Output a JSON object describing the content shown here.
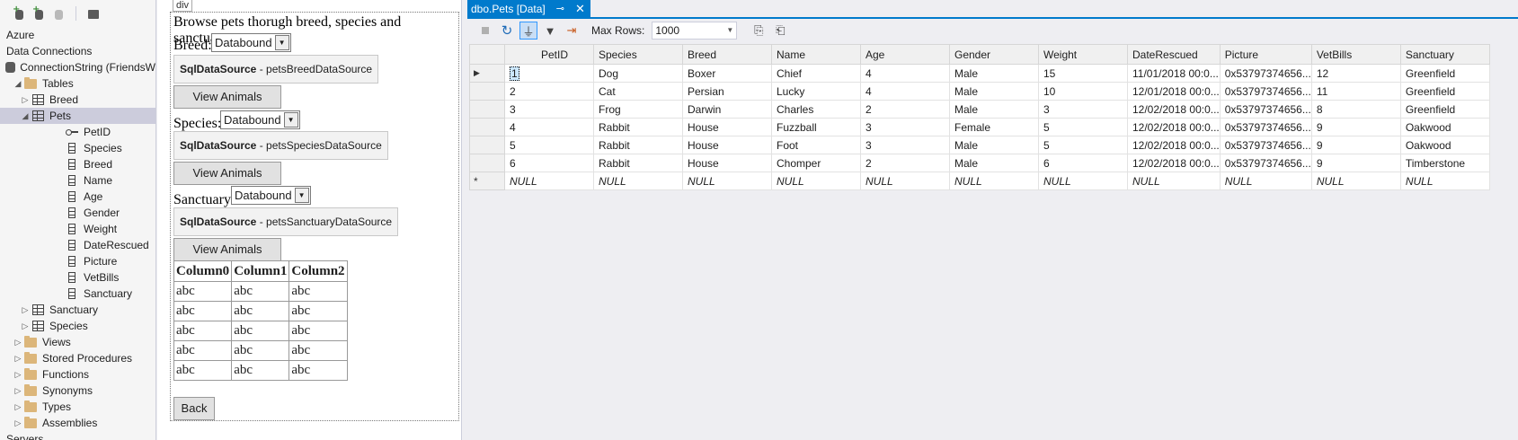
{
  "explorer": {
    "tree": [
      {
        "label": "Azure",
        "indent": 0,
        "arrow": "",
        "icon": "none"
      },
      {
        "label": "Data Connections",
        "indent": 0,
        "arrow": "",
        "icon": "none"
      },
      {
        "label": "ConnectionString (FriendsW",
        "indent": 0,
        "arrow": "",
        "icon": "db"
      },
      {
        "label": "Tables",
        "indent": 1,
        "arrow": "◢",
        "icon": "folder"
      },
      {
        "label": "Breed",
        "indent": 2,
        "arrow": "▷",
        "icon": "table"
      },
      {
        "label": "Pets",
        "indent": 2,
        "arrow": "◢",
        "icon": "table",
        "selected": true
      },
      {
        "label": "PetID",
        "indent": 4,
        "arrow": "",
        "icon": "key"
      },
      {
        "label": "Species",
        "indent": 4,
        "arrow": "",
        "icon": "col"
      },
      {
        "label": "Breed",
        "indent": 4,
        "arrow": "",
        "icon": "col"
      },
      {
        "label": "Name",
        "indent": 4,
        "arrow": "",
        "icon": "col"
      },
      {
        "label": "Age",
        "indent": 4,
        "arrow": "",
        "icon": "col"
      },
      {
        "label": "Gender",
        "indent": 4,
        "arrow": "",
        "icon": "col"
      },
      {
        "label": "Weight",
        "indent": 4,
        "arrow": "",
        "icon": "col"
      },
      {
        "label": "DateRescued",
        "indent": 4,
        "arrow": "",
        "icon": "col"
      },
      {
        "label": "Picture",
        "indent": 4,
        "arrow": "",
        "icon": "col"
      },
      {
        "label": "VetBills",
        "indent": 4,
        "arrow": "",
        "icon": "col"
      },
      {
        "label": "Sanctuary",
        "indent": 4,
        "arrow": "",
        "icon": "col"
      },
      {
        "label": "Sanctuary",
        "indent": 2,
        "arrow": "▷",
        "icon": "table"
      },
      {
        "label": "Species",
        "indent": 2,
        "arrow": "▷",
        "icon": "table"
      },
      {
        "label": "Views",
        "indent": 1,
        "arrow": "▷",
        "icon": "folder"
      },
      {
        "label": "Stored Procedures",
        "indent": 1,
        "arrow": "▷",
        "icon": "folder"
      },
      {
        "label": "Functions",
        "indent": 1,
        "arrow": "▷",
        "icon": "folder"
      },
      {
        "label": "Synonyms",
        "indent": 1,
        "arrow": "▷",
        "icon": "folder"
      },
      {
        "label": "Types",
        "indent": 1,
        "arrow": "▷",
        "icon": "folder"
      },
      {
        "label": "Assemblies",
        "indent": 1,
        "arrow": "▷",
        "icon": "folder"
      },
      {
        "label": "Servers",
        "indent": 0,
        "arrow": "",
        "icon": "none"
      }
    ]
  },
  "designer": {
    "div_tag": "div",
    "heading": "Browse pets thorugh breed, species and sanctuary:",
    "breed_label": "Breed:",
    "species_label": "Species:",
    "sanctuary_label": "Sanctuary:",
    "dropdown_value": "Databound",
    "sqlds_type": "SqlDataSource",
    "breed_ds": " - petsBreedDataSource",
    "species_ds": " - petsSpeciesDataSource",
    "sanctuary_ds": " - petsSanctuaryDataSource",
    "view_button": "View Animals",
    "grid_headers": [
      "Column0",
      "Column1",
      "Column2"
    ],
    "grid_cell": "abc",
    "back_button": "Back"
  },
  "datawin": {
    "tab_title": "dbo.Pets [Data]",
    "pin_glyph": "⊸",
    "close_glyph": "✕",
    "max_rows_label": "Max Rows:",
    "max_rows_value": "1000",
    "columns": [
      "PetID",
      "Species",
      "Breed",
      "Name",
      "Age",
      "Gender",
      "Weight",
      "DateRescued",
      "Picture",
      "VetBills",
      "Sanctuary"
    ],
    "rows": [
      [
        "1",
        "Dog",
        "Boxer",
        "Chief",
        "4",
        "Male",
        "15",
        "11/01/2018 00:0...",
        "0x53797374656...",
        "12",
        "Greenfield"
      ],
      [
        "2",
        "Cat",
        "Persian",
        "Lucky",
        "4",
        "Male",
        "10",
        "12/01/2018 00:0...",
        "0x53797374656...",
        "11",
        "Greenfield"
      ],
      [
        "3",
        "Frog",
        "Darwin",
        "Charles",
        "2",
        "Male",
        "3",
        "12/02/2018 00:0...",
        "0x53797374656...",
        "8",
        "Greenfield"
      ],
      [
        "4",
        "Rabbit",
        "House",
        "Fuzzball",
        "3",
        "Female",
        "5",
        "12/02/2018 00:0...",
        "0x53797374656...",
        "9",
        "Oakwood"
      ],
      [
        "5",
        "Rabbit",
        "House",
        "Foot",
        "3",
        "Male",
        "5",
        "12/02/2018 00:0...",
        "0x53797374656...",
        "9",
        "Oakwood"
      ],
      [
        "6",
        "Rabbit",
        "House",
        "Chomper",
        "2",
        "Male",
        "6",
        "12/02/2018 00:0...",
        "0x53797374656...",
        "9",
        "Timberstone"
      ]
    ],
    "new_row_marker": "*",
    "null_text": "NULL",
    "current_row_marker": "▶"
  }
}
